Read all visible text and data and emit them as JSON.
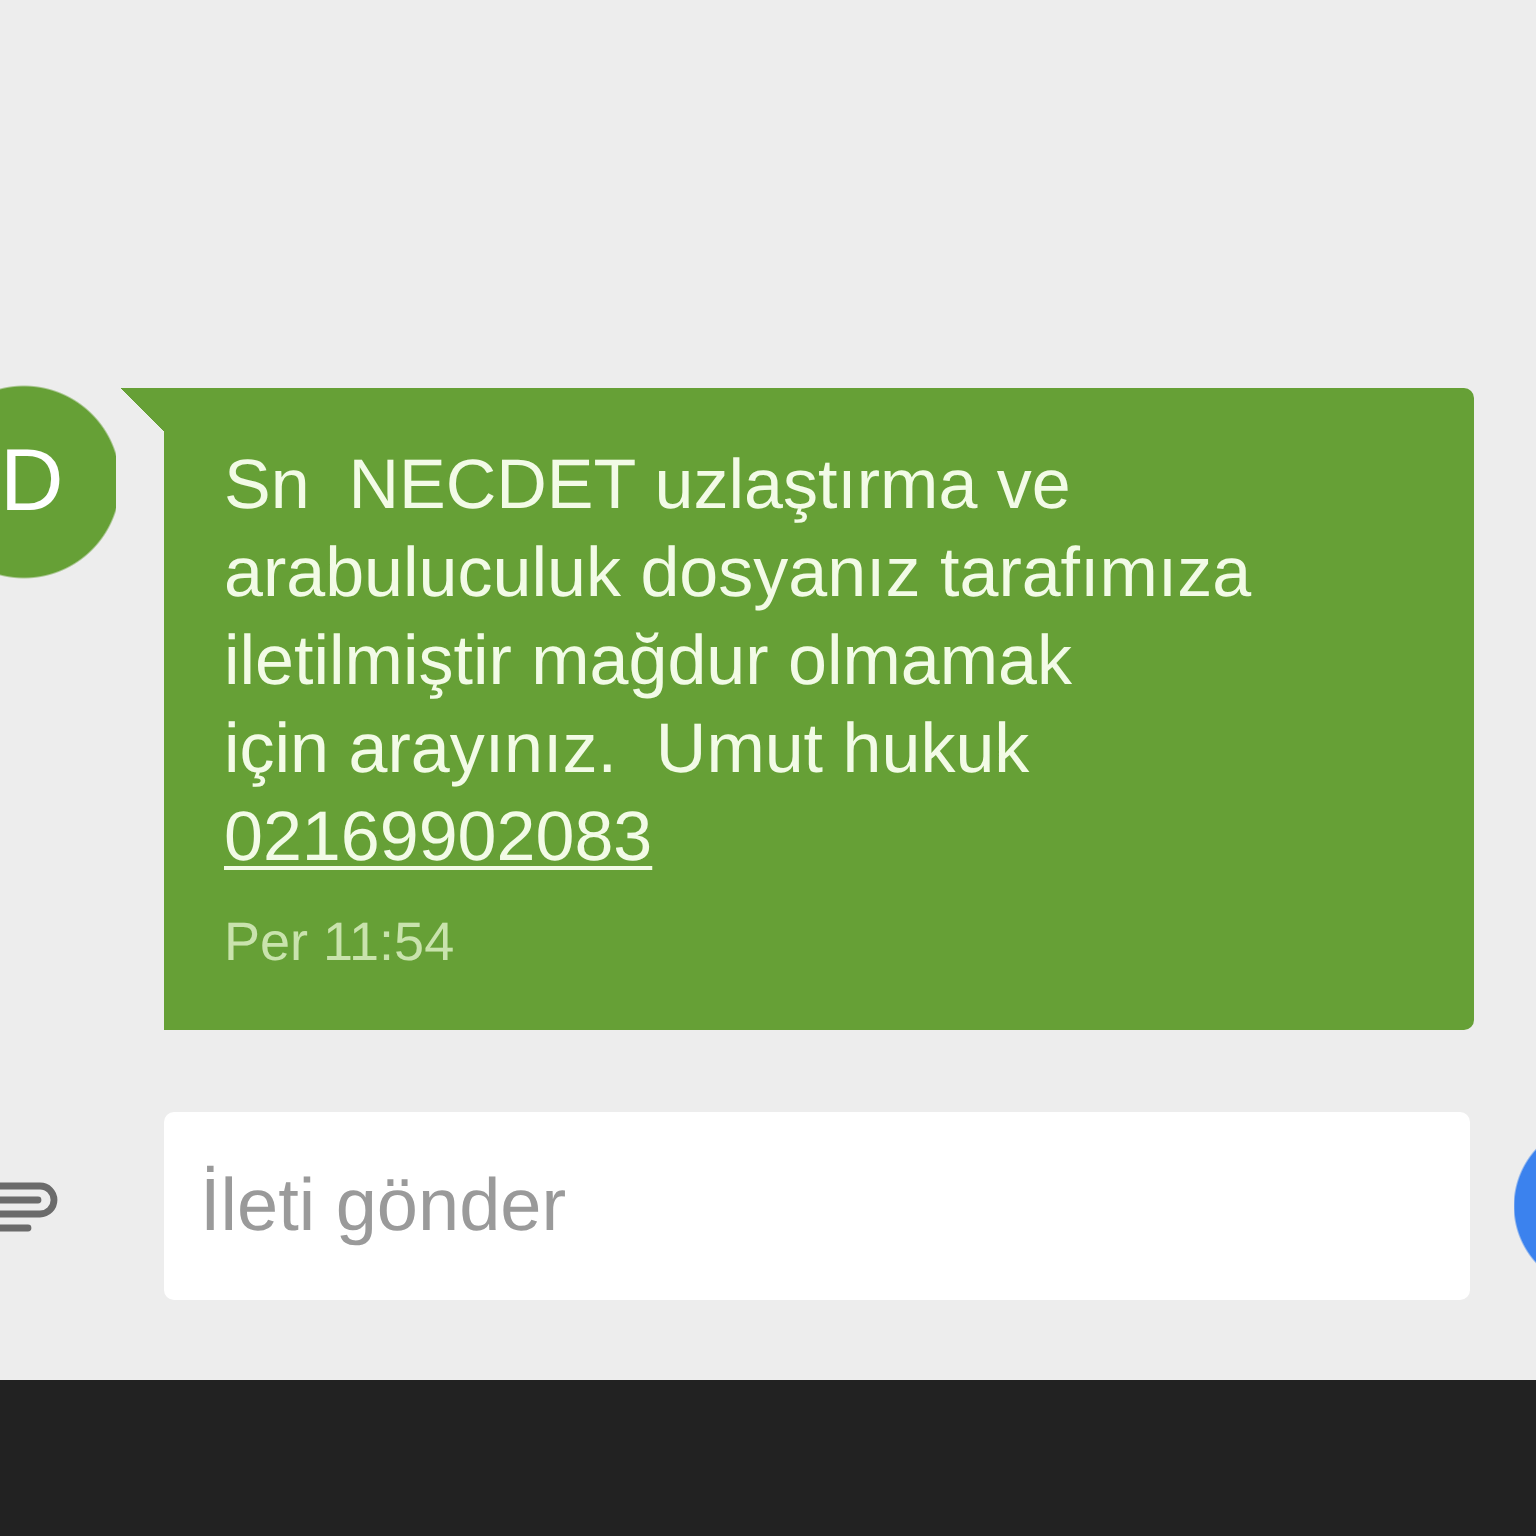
{
  "conversation": {
    "messages": [
      {
        "kind": "incoming",
        "avatar_letter": "D",
        "text": "Sn  NECDET uzlaştırma ve\narabuluculuk dosyanız tarafımıza\niletilmiştir mağdur olmamak\niçin arayınız.  Umut hukuk",
        "phone_link": "02169902083",
        "time": "Per 11:54"
      }
    ]
  },
  "composer": {
    "placeholder": "İleti gönder"
  }
}
